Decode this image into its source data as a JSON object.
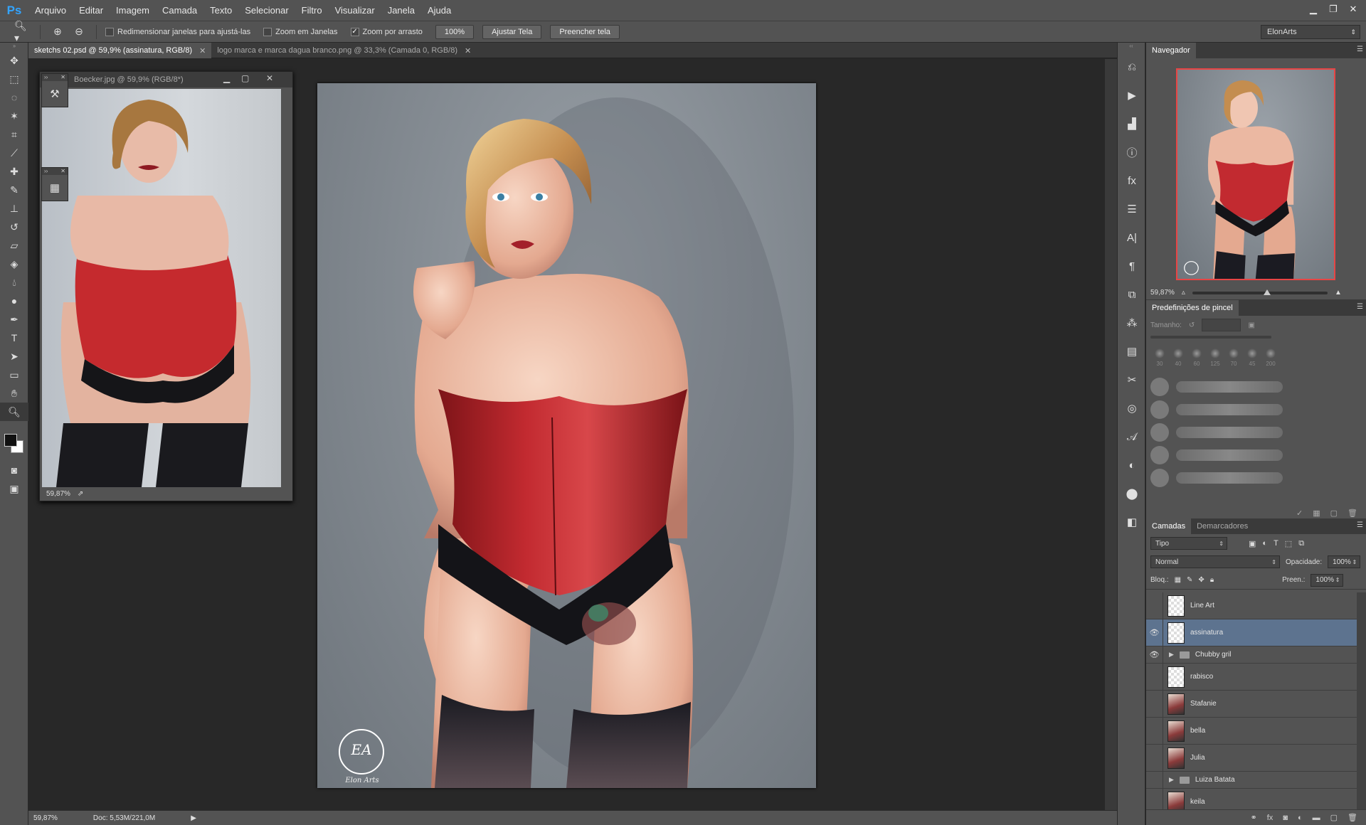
{
  "app": {
    "logo": "Ps"
  },
  "menu": [
    "Arquivo",
    "Editar",
    "Imagem",
    "Camada",
    "Texto",
    "Selecionar",
    "Filtro",
    "Visualizar",
    "Janela",
    "Ajuda"
  ],
  "options_bar": {
    "resize_windows_label": "Redimensionar janelas para ajustá-las",
    "zoom_all_label": "Zoom em Janelas",
    "scrubby_zoom_label": "Zoom por arrasto",
    "zoom_100_label": "100%",
    "fit_screen_label": "Ajustar Tela",
    "fill_screen_label": "Preencher tela",
    "workspace": "ElonArts"
  },
  "tabs": [
    {
      "label": "sketchs 02.psd @ 59,9% (assinatura, RGB/8)",
      "active": true
    },
    {
      "label": "logo marca e marca dagua branco.png @ 33,3% (Camada 0, RGB/8)",
      "active": false
    }
  ],
  "float_window": {
    "title": "Boecker.jpg @ 59,9% (RGB/8*)",
    "zoom": "59,87%"
  },
  "status_bar": {
    "zoom": "59,87%",
    "doc": "Doc: 5,53M/221,0M"
  },
  "watermark": {
    "initials": "EA",
    "name": "Elon Arts"
  },
  "navigator": {
    "tab": "Navegador",
    "zoom": "59,87%"
  },
  "brush_presets": {
    "tab": "Predefinições de pincel",
    "size_label": "Tamanho:",
    "sizes": [
      "30",
      "40",
      "60",
      "125",
      "70",
      "45",
      "200"
    ]
  },
  "layers_panel": {
    "tabs": [
      "Camadas",
      "Demarcadores"
    ],
    "filter": "Tipo",
    "blend_mode": "Normal",
    "opacity_label": "Opacidade:",
    "opacity": "100%",
    "lock_label": "Bloq.:",
    "fill_label": "Preen.:",
    "fill": "100%",
    "layers": [
      {
        "name": "Line Art",
        "visible": false,
        "type": "layer",
        "selected": false
      },
      {
        "name": "assinatura",
        "visible": true,
        "type": "layer",
        "selected": true
      },
      {
        "name": "Chubby gril",
        "visible": true,
        "type": "group",
        "selected": false
      },
      {
        "name": "rabisco",
        "visible": false,
        "type": "layer",
        "selected": false
      },
      {
        "name": "Stafanie",
        "visible": false,
        "type": "photo",
        "selected": false
      },
      {
        "name": "bella",
        "visible": false,
        "type": "photo",
        "selected": false
      },
      {
        "name": "Julia",
        "visible": false,
        "type": "photo",
        "selected": false
      },
      {
        "name": "Luiza Batata",
        "visible": false,
        "type": "group",
        "selected": false
      },
      {
        "name": "keila",
        "visible": false,
        "type": "photo",
        "selected": false
      }
    ]
  }
}
